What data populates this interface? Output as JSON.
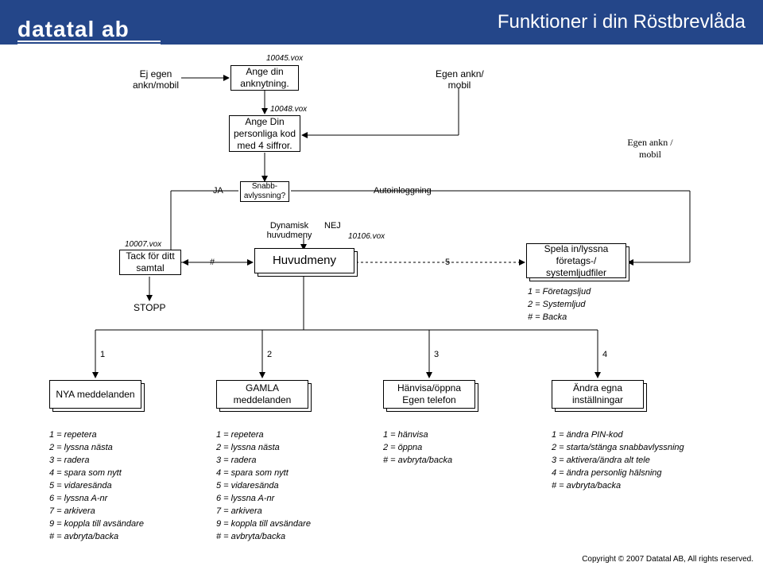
{
  "header": {
    "logo_text": "datatal ab",
    "title": "Funktioner i din Röstbrevlåda"
  },
  "top": {
    "ej_egen": "Ej egen\nankn/mobil",
    "ange_ankn": "Ange din\nanknytning.",
    "ange_ankn_vox": "10045.vox",
    "egen_ankn": "Egen ankn/\nmobil",
    "ange_kod": "Ange Din\npersonliga kod\nmed 4 siffror.",
    "ange_kod_vox": "10048.vox",
    "egen_ankn_right": "Egen ankn /\nmobil"
  },
  "mid": {
    "ja": "JA",
    "snabb": "Snabb-\navlyssning?",
    "autoin": "Autoinloggning",
    "dyn_meny": "Dynamisk\nhuvudmeny",
    "nej": "NEJ",
    "vox10106": "10106.vox",
    "tack_vox": "10007.vox",
    "tack": "Tack för ditt\nsamtal",
    "hash": "#",
    "huvudmeny": "Huvudmeny",
    "five": "5",
    "spela": "Spela in/lyssna\nföretags-/\nsystemljudfiler",
    "stopp": "STOPP",
    "legend": "1 = Företagsljud\n2 = Systemljud\n# = Backa"
  },
  "branch_nums": {
    "b1": "1",
    "b2": "2",
    "b3": "3",
    "b4": "4"
  },
  "opts": {
    "nya": "NYA\nmeddelanden",
    "gamla": "GAMLA\nmeddelanden",
    "hanvisa": "Hänvisa/öppna\nEgen telefon",
    "andra": "Ändra egna\ninställningar"
  },
  "lists": {
    "l1": "1 = repetera\n2 = lyssna nästa\n3 = radera\n4 = spara som nytt\n5 = vidaresända\n6 = lyssna A-nr\n7 = arkivera\n9 = koppla till avsändare\n# = avbryta/backa",
    "l2": "1 = repetera\n2 = lyssna nästa\n3 = radera\n4 = spara som nytt\n5 = vidaresända\n6 = lyssna A-nr\n7 = arkivera\n9 = koppla till avsändare\n# = avbryta/backa",
    "l3": "1 = hänvisa\n2 = öppna\n# = avbryta/backa",
    "l4": "1 = ändra PIN-kod\n2 = starta/stänga snabbavlyssning\n3 = aktivera/ändra alt tele\n4 = ändra personlig hälsning\n# = avbryta/backa"
  },
  "copyright": "Copyright © 2007 Datatal AB, All rights reserved."
}
